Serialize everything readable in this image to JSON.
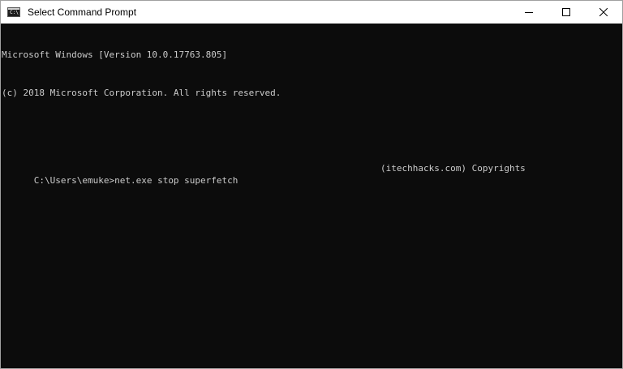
{
  "window": {
    "title": "Select Command Prompt",
    "icon": "cmd-icon",
    "icon_text": "C:\\"
  },
  "controls": {
    "minimize": "minimize-icon",
    "maximize": "maximize-icon",
    "close": "close-icon"
  },
  "console": {
    "line1": "Microsoft Windows [Version 10.0.17763.805]",
    "line2": "(c) 2018 Microsoft Corporation. All rights reserved.",
    "line3": "",
    "line4": "C:\\Users\\emuke>net.exe stop superfetch",
    "watermark": "(itechhacks.com) Copyrights"
  },
  "colors": {
    "background": "#0c0c0c",
    "text": "#cccccc",
    "titlebar": "#ffffff"
  }
}
